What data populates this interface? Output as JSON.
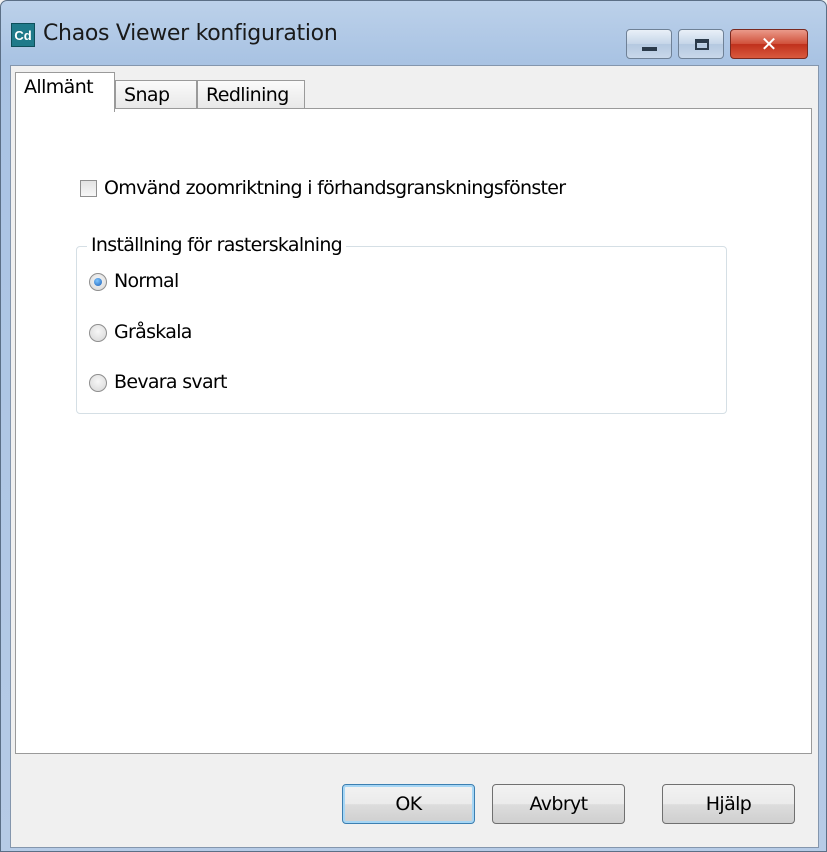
{
  "window": {
    "app_icon_text": "Cd",
    "title": "Chaos Viewer konfiguration",
    "controls": {
      "minimize": "minimize",
      "maximize": "maximize",
      "close": "close"
    }
  },
  "tabs": [
    {
      "label": "Allmänt",
      "active": true
    },
    {
      "label": "Snap",
      "active": false
    },
    {
      "label": "Redlining",
      "active": false
    }
  ],
  "general": {
    "reverse_zoom": {
      "label": "Omvänd zoomriktning i förhandsgranskningsfönster",
      "checked": false
    },
    "raster_scaling": {
      "legend": "Inställning för rasterskalning",
      "options": [
        {
          "label": "Normal",
          "selected": true
        },
        {
          "label": "Gråskala",
          "selected": false
        },
        {
          "label": "Bevara svart",
          "selected": false
        }
      ]
    }
  },
  "buttons": {
    "ok": "OK",
    "cancel": "Avbryt",
    "help": "Hjälp"
  }
}
